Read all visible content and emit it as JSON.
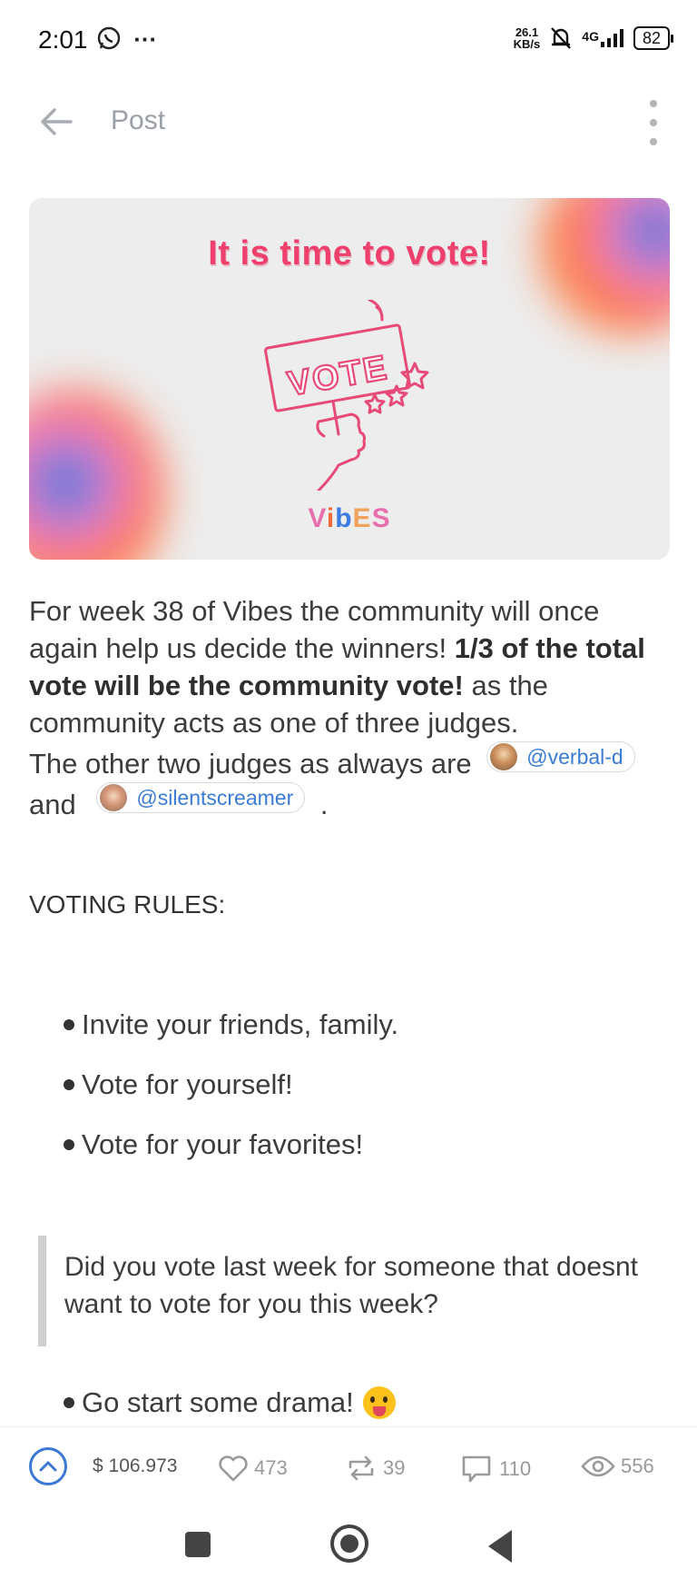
{
  "status_bar": {
    "time": "2:01",
    "speed_value": "26.1",
    "speed_unit": "KB/s",
    "network": "4G",
    "battery": "82",
    "icons": [
      "whatsapp-icon",
      "more-dots-icon",
      "bell-muted-icon",
      "signal-icon"
    ]
  },
  "app_bar": {
    "title": "Post",
    "icons": [
      "back-arrow-icon",
      "more-vertical-icon"
    ]
  },
  "banner": {
    "headline": "It is time to vote!",
    "sign_text": "VOTE",
    "logo_letters": [
      "V",
      "i",
      "b",
      "E",
      "S"
    ],
    "colors": {
      "headline": "#ee3f6d",
      "blob_orange": "#ff7a3a",
      "blob_blue": "#3c7be0",
      "blob_pink": "#f07cc8"
    }
  },
  "post": {
    "p1_a": "For week 38 of Vibes the community will once again help us decide the winners! ",
    "p1_bold": "1/3 of the total vote will be the community vote!",
    "p1_b": " as the community acts as one of three judges.",
    "p2_a": "The other two judges as always are",
    "mention1": "@verbal-d",
    "p2_b": "and",
    "mention2": "@silentscreamer",
    "p2_end": ".",
    "rules_heading": "VOTING RULES:",
    "rules": [
      "Invite your friends, family.",
      "Vote for yourself!",
      "Vote for your favorites!"
    ],
    "quote": "Did you vote last week for someone that doesnt want to vote for you this week?",
    "last_bullet": "Go start some drama!"
  },
  "actions": {
    "payout": "$ 106.973",
    "likes": "473",
    "reblogs": "39",
    "comments": "110",
    "views": "556",
    "accent": "#3b78d6"
  }
}
